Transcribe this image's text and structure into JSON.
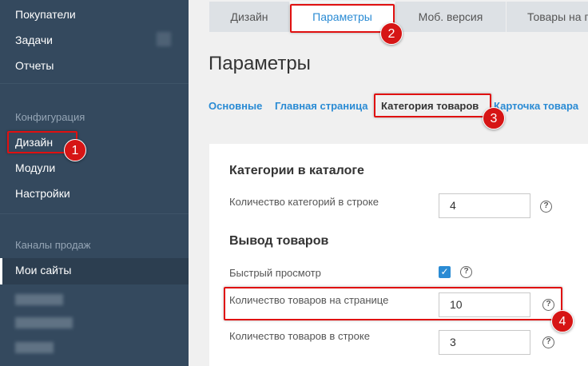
{
  "sidebar": {
    "items_top": [
      {
        "label": "Покупатели"
      },
      {
        "label": "Задачи"
      },
      {
        "label": "Отчеты"
      }
    ],
    "config_heading": "Конфигурация",
    "config_items": [
      {
        "label": "Дизайн"
      },
      {
        "label": "Модули"
      },
      {
        "label": "Настройки"
      }
    ],
    "channels_heading": "Каналы продаж",
    "channels_items": [
      {
        "label": "Мои сайты"
      }
    ]
  },
  "top_tabs": [
    {
      "label": "Дизайн"
    },
    {
      "label": "Параметры"
    },
    {
      "label": "Моб. версия"
    },
    {
      "label": "Товары на г"
    }
  ],
  "page_title": "Параметры",
  "sub_tabs": [
    {
      "label": "Основные"
    },
    {
      "label": "Главная страница"
    },
    {
      "label": "Категория товаров"
    },
    {
      "label": "Карточка товара"
    }
  ],
  "panel": {
    "section1_title": "Категории в каталоге",
    "categories_per_row_label": "Количество категорий в строке",
    "categories_per_row_value": "4",
    "section2_title": "Вывод товаров",
    "quick_view_label": "Быстрый просмотр",
    "quick_view_checked": true,
    "products_per_page_label": "Количество товаров на странице",
    "products_per_page_value": "10",
    "products_per_row_label": "Количество товаров в строке",
    "products_per_row_value": "3",
    "help_glyph": "?",
    "check_glyph": "✓"
  },
  "annotations": [
    "1",
    "2",
    "3",
    "4"
  ],
  "colors": {
    "sidebar_bg": "#34495e",
    "accent": "#2a8bd4",
    "highlight": "#e01010"
  }
}
